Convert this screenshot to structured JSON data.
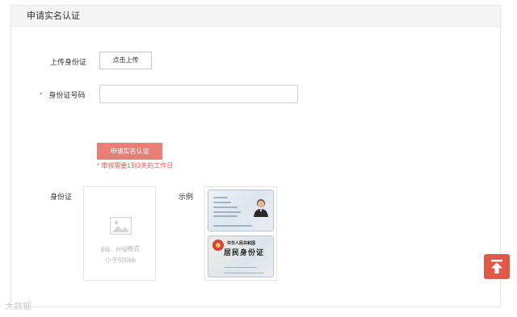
{
  "panel": {
    "title": "申请实名认证"
  },
  "form": {
    "upload_label": "上传身份证",
    "upload_button": "点击上传",
    "required_mark": "*",
    "id_number_label": "身份证号码",
    "id_number_value": "",
    "apply_button": "申请实名认证",
    "note": "* 审核需要1到3天的工作日",
    "id_card_label": "身份证",
    "upload_hint_line1": "jpg、png格式",
    "upload_hint_line2": "小于500kb",
    "example_label": "示例",
    "card_back_title": "中华人民共和国",
    "card_back_big": "居民身份证"
  },
  "watermark": "大数据",
  "colors": {
    "accent": "#e05a47",
    "apply_button": "#e8807a",
    "note": "#e05a4a"
  },
  "icons": [
    "image-placeholder-icon",
    "arrow-to-top-icon"
  ]
}
